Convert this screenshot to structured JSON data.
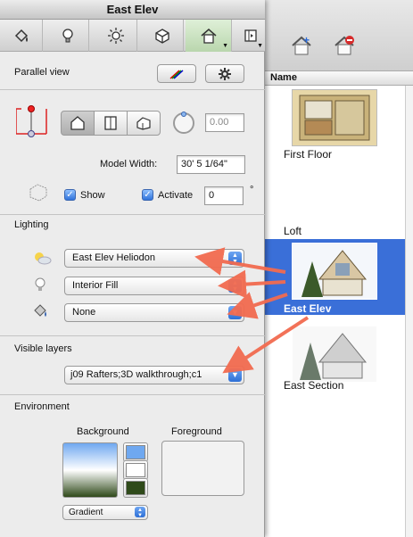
{
  "window": {
    "title": "East Elev"
  },
  "tabs": [
    {
      "icon": "paint-bucket-icon"
    },
    {
      "icon": "lightbulb-icon"
    },
    {
      "icon": "sun-icon"
    },
    {
      "icon": "cube-icon"
    },
    {
      "icon": "house-icon"
    }
  ],
  "parallel_view": {
    "title": "Parallel view",
    "angle_value": "0.00"
  },
  "model_width": {
    "label": "Model Width:",
    "value": "30' 5 1/64\""
  },
  "cutting_plane": {
    "show_label": "Show",
    "activate_label": "Activate",
    "offset_value": "0",
    "offset_unit": "°"
  },
  "lighting": {
    "title": "Lighting",
    "heliodon": "East Elev Heliodon",
    "light": "Interior Fill",
    "fill": "None"
  },
  "visible_layers": {
    "title": "Visible layers",
    "value": "j09   Rafters;3D walkthrough;c1"
  },
  "environment": {
    "title": "Environment",
    "background_label": "Background",
    "foreground_label": "Foreground",
    "background_type": "Gradient",
    "colors": {
      "top": "#6fa8f0",
      "middle": "#ffffff",
      "bottom": "#2f4a1a"
    }
  },
  "views_panel": {
    "column_header": "Name",
    "items": [
      {
        "label": "First Floor"
      },
      {
        "label": "Loft"
      },
      {
        "label": "East Elev"
      },
      {
        "label": "East Section"
      }
    ]
  }
}
